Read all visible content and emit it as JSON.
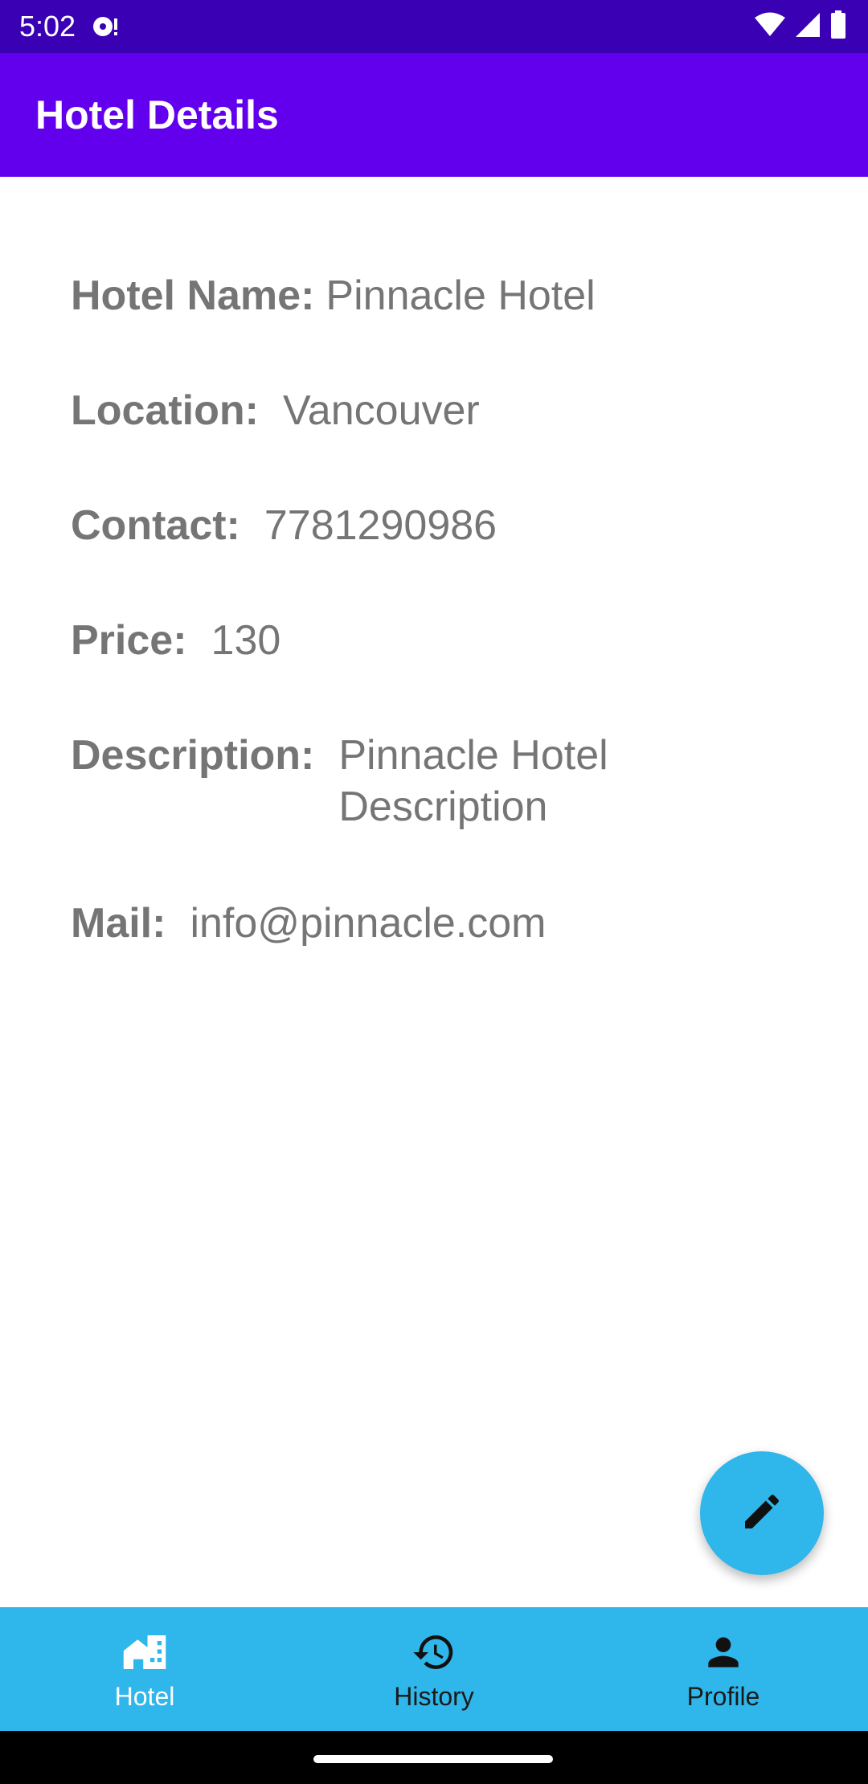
{
  "status_bar": {
    "time": "5:02"
  },
  "app_bar": {
    "title": "Hotel Details"
  },
  "hotel": {
    "name_label": "Hotel Name:",
    "name_value": "Pinnacle Hotel",
    "location_label": "Location:",
    "location_value": "Vancouver",
    "contact_label": "Contact:",
    "contact_value": "7781290986",
    "price_label": "Price:",
    "price_value": "130",
    "description_label": "Description:",
    "description_value": "Pinnacle Hotel Description",
    "mail_label": "Mail:",
    "mail_value": "info@pinnacle.com"
  },
  "fab": {
    "icon": "edit-pencil-icon"
  },
  "bottom_nav": {
    "items": [
      {
        "label": "Hotel",
        "icon": "hotel-icon",
        "active": true
      },
      {
        "label": "History",
        "icon": "history-icon",
        "active": false
      },
      {
        "label": "Profile",
        "icon": "person-icon",
        "active": false
      }
    ]
  },
  "colors": {
    "status_bar": "#3a00b3",
    "app_bar": "#6200ee",
    "accent": "#2fb6ea",
    "text_gray": "#757575"
  }
}
